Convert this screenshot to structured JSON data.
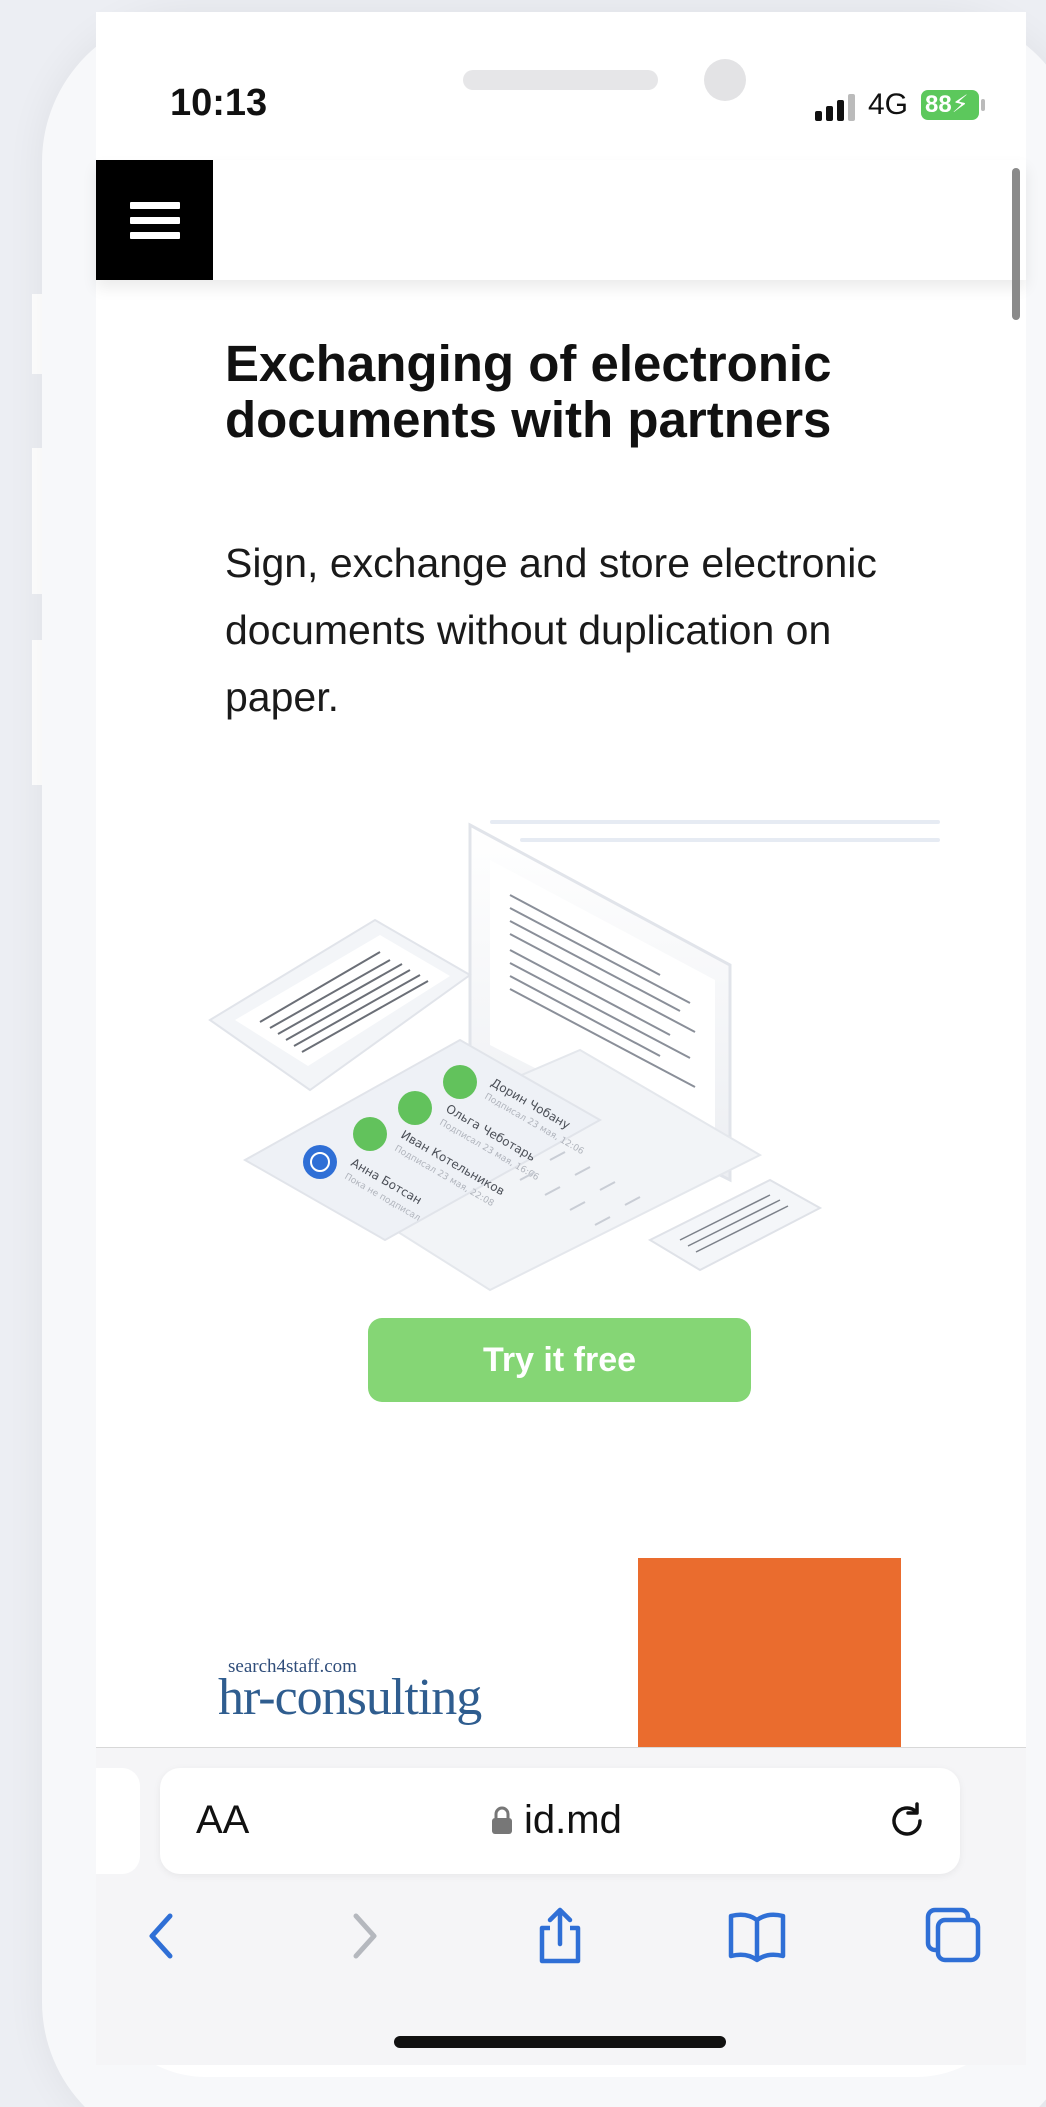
{
  "status_bar": {
    "time": "10:13",
    "network": "4G",
    "battery": "88"
  },
  "header": {
    "menu_icon": "hamburger-icon"
  },
  "hero": {
    "title": "Exchanging of electronic documents with partners",
    "subtitle": "Sign, exchange and store electronic documents without duplication on paper.",
    "cta_label": "Try it free"
  },
  "illustration": {
    "signers": [
      {
        "name": "Дорин Чобану",
        "status": "Подписал 23 мая, 12:06"
      },
      {
        "name": "Ольга Чеботарь",
        "status": "Подписал 23 мая, 16:06"
      },
      {
        "name": "Иван Котельников",
        "status": "Подписал 23 мая, 22:08"
      },
      {
        "name": "Анна Ботсан",
        "status": "Пока не подписал"
      }
    ]
  },
  "partners": {
    "hr_logo_small": "search4staff.com",
    "hr_logo_big": "hr-consulting"
  },
  "browser": {
    "text_size_label": "AA",
    "url": "id.md",
    "icons": [
      "back-icon",
      "forward-icon",
      "share-icon",
      "bookmarks-icon",
      "tabs-icon",
      "reload-icon",
      "lock-icon"
    ]
  },
  "colors": {
    "cta": "#85d675",
    "accent_blue": "#2f6fd6",
    "orange": "#ea6c2e",
    "battery": "#5cc85c"
  }
}
